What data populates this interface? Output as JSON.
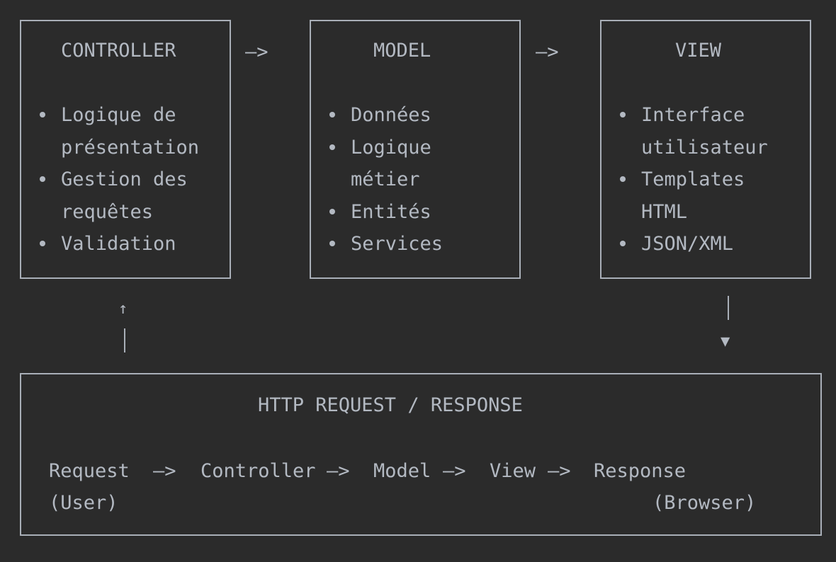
{
  "boxes": {
    "controller": {
      "title": "CONTROLLER",
      "items": [
        "Logique de",
        "présentation",
        "Gestion des",
        "requêtes",
        "Validation"
      ]
    },
    "model": {
      "title": "MODEL",
      "items": [
        "Données",
        "Logique",
        "métier",
        "Entités",
        "Services"
      ]
    },
    "view": {
      "title": "VIEW",
      "items": [
        "Interface",
        "utilisateur",
        "Templates",
        "HTML",
        "JSON/XML"
      ]
    }
  },
  "arrows": {
    "right": "—>",
    "up": "↑",
    "down": "▼"
  },
  "http": {
    "title": "HTTP REQUEST / RESPONSE",
    "flow": [
      "Request",
      "Controller",
      "Model",
      "View",
      "Response"
    ],
    "user_note": "(User)",
    "browser_note": "(Browser)"
  }
}
